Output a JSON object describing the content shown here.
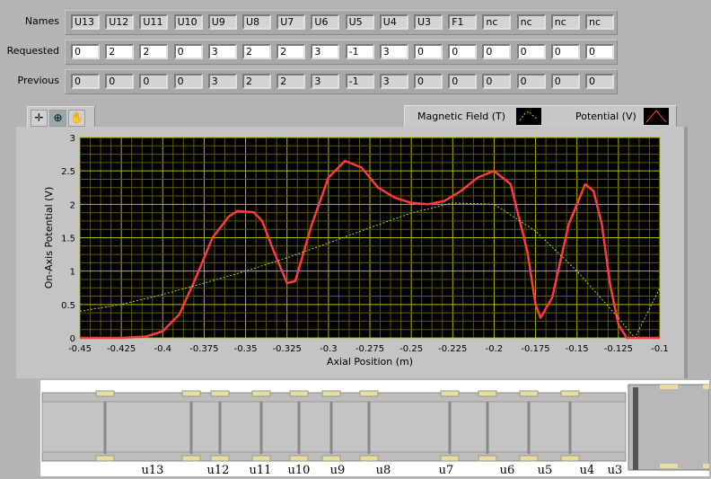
{
  "table": {
    "row_labels": [
      "Names",
      "Requested",
      "Previous"
    ],
    "names": [
      "U13",
      "U12",
      "U11",
      "U10",
      "U9",
      "U8",
      "U7",
      "U6",
      "U5",
      "U4",
      "U3",
      "F1",
      "nc",
      "nc",
      "nc",
      "nc"
    ],
    "requested": [
      "0",
      "2",
      "2",
      "0",
      "3",
      "2",
      "2",
      "3",
      "-1",
      "3",
      "0",
      "0",
      "0",
      "0",
      "0",
      "0"
    ],
    "previous": [
      "0",
      "0",
      "0",
      "0",
      "3",
      "2",
      "2",
      "3",
      "-1",
      "3",
      "0",
      "0",
      "0",
      "0",
      "0",
      "0"
    ]
  },
  "toolbar": {
    "tools": [
      "crosshair-cursor-icon",
      "zoom-icon",
      "pan-hand-icon"
    ]
  },
  "legend": {
    "magnetic_label": "Magnetic Field (T)",
    "potential_label": "Potential (V)"
  },
  "colors": {
    "potential": "#ff3b3b",
    "magnetic": "#a0e020",
    "plot_bg": "#000000",
    "grid_major": "#b8b800",
    "grid_minor": "#5a5a00"
  },
  "chart_data": {
    "type": "line",
    "xlabel": "Axial Position (m)",
    "ylabel": "On-Axis Potential (V)",
    "xlim": [
      -0.45,
      -0.1
    ],
    "ylim": [
      0,
      3
    ],
    "grid": true,
    "legend_position": "top-right",
    "x_ticks": [
      "-0.45",
      "-0.425",
      "-0.4",
      "-0.375",
      "-0.35",
      "-0.325",
      "-0.3",
      "-0.275",
      "-0.25",
      "-0.225",
      "-0.2",
      "-0.175",
      "-0.15",
      "-0.125",
      "-0.1"
    ],
    "y_ticks": [
      "0",
      "0.5",
      "1",
      "1.5",
      "2",
      "2.5",
      "3"
    ],
    "series": [
      {
        "name": "Potential (V)",
        "x": [
          -0.45,
          -0.425,
          -0.41,
          -0.4,
          -0.39,
          -0.38,
          -0.37,
          -0.36,
          -0.355,
          -0.345,
          -0.34,
          -0.333,
          -0.325,
          -0.32,
          -0.31,
          -0.3,
          -0.29,
          -0.28,
          -0.27,
          -0.26,
          -0.25,
          -0.24,
          -0.23,
          -0.22,
          -0.21,
          -0.2,
          -0.19,
          -0.18,
          -0.175,
          -0.172,
          -0.165,
          -0.155,
          -0.145,
          -0.14,
          -0.135,
          -0.13,
          -0.125,
          -0.12,
          -0.1
        ],
        "y": [
          0,
          0,
          0.02,
          0.1,
          0.35,
          0.9,
          1.5,
          1.82,
          1.9,
          1.88,
          1.75,
          1.3,
          0.82,
          0.85,
          1.7,
          2.4,
          2.65,
          2.55,
          2.25,
          2.1,
          2.02,
          2.0,
          2.05,
          2.2,
          2.4,
          2.5,
          2.3,
          1.3,
          0.5,
          0.3,
          0.6,
          1.7,
          2.3,
          2.2,
          1.7,
          0.8,
          0.2,
          0,
          0
        ]
      },
      {
        "name": "Magnetic Field (T)",
        "x": [
          -0.45,
          -0.425,
          -0.4,
          -0.375,
          -0.35,
          -0.325,
          -0.3,
          -0.275,
          -0.25,
          -0.225,
          -0.2,
          -0.175,
          -0.15,
          -0.125,
          -0.115,
          -0.1
        ],
        "y": [
          0.4,
          0.5,
          0.65,
          0.82,
          1.0,
          1.2,
          1.42,
          1.65,
          1.87,
          2.02,
          2.0,
          1.6,
          1.0,
          0.3,
          0.0,
          0.75
        ]
      }
    ]
  },
  "drawing": {
    "labels": [
      "u13",
      "u12",
      "u11",
      "u10",
      "u9",
      "u8",
      "u7",
      "u6",
      "u5",
      "u4",
      "u3"
    ]
  }
}
